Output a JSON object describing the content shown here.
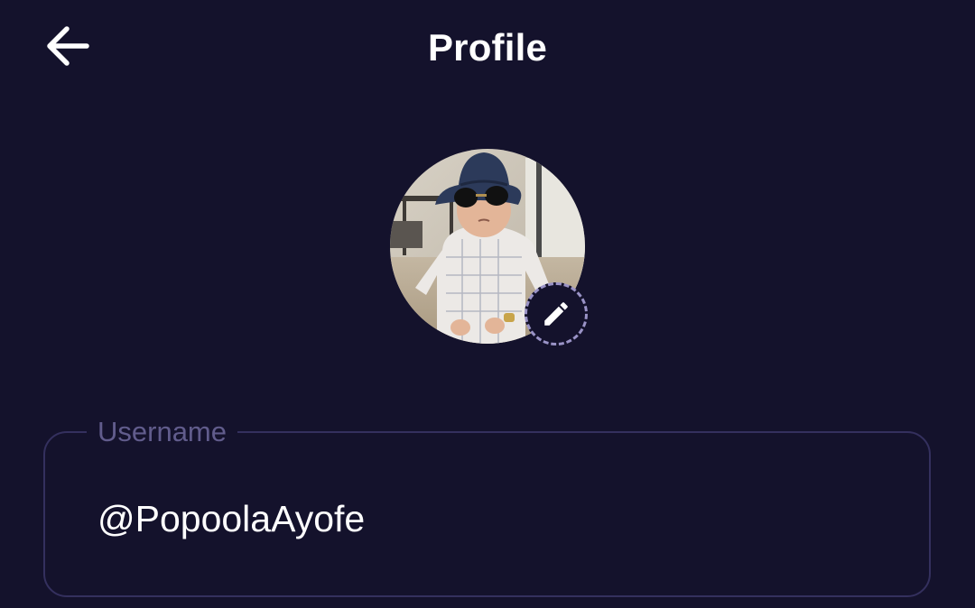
{
  "header": {
    "title": "Profile",
    "back_icon": "arrow-left-icon"
  },
  "avatar": {
    "edit_icon": "pencil-icon",
    "edit_ring_color": "#9a93c7"
  },
  "username_field": {
    "label": "Username",
    "value": "@PopoolaAyofe"
  },
  "colors": {
    "background": "#14122c",
    "field_border": "#34305e",
    "label_text": "#615c8c",
    "primary_text": "#ffffff"
  }
}
